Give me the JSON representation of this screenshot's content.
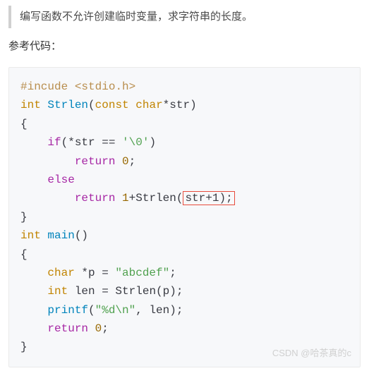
{
  "quote": "编写函数不允许创建临时变量，求字符串的长度。",
  "section_label": "参考代码：",
  "code": {
    "line1_include": "#incude",
    "line1_header": "<stdio.h>",
    "line2_type": "int",
    "line2_fn": "Strlen",
    "line2_const": "const",
    "line2_char": "char",
    "line2_param": "*str)",
    "line3": "{",
    "line4_if": "if",
    "line4_expr": "(*str == ",
    "line4_char": "'\\0'",
    "line4_close": ")",
    "line5_return": "return",
    "line5_val": "0",
    "line5_semi": ";",
    "line6_else": "else",
    "line7_return": "return",
    "line7_one": "1",
    "line7_plus_fn": "+Strlen(",
    "line7_box": "str+1);",
    "line8": "}",
    "line9_type": "int",
    "line9_fn": "main",
    "line9_paren": "()",
    "line10": "{",
    "line11_char": "char",
    "line11_var": " *p = ",
    "line11_str": "\"abcdef\"",
    "line11_semi": ";",
    "line12_type": "int",
    "line12_var": " len = Strlen(p);",
    "line13_fn": "printf",
    "line13_open": "(",
    "line13_fmt": "\"%d\\n\"",
    "line13_rest": ", len);",
    "line14_return": "return",
    "line14_val": "0",
    "line14_semi": ";",
    "line15": "}"
  },
  "watermark": "CSDN @哈茶真的c"
}
